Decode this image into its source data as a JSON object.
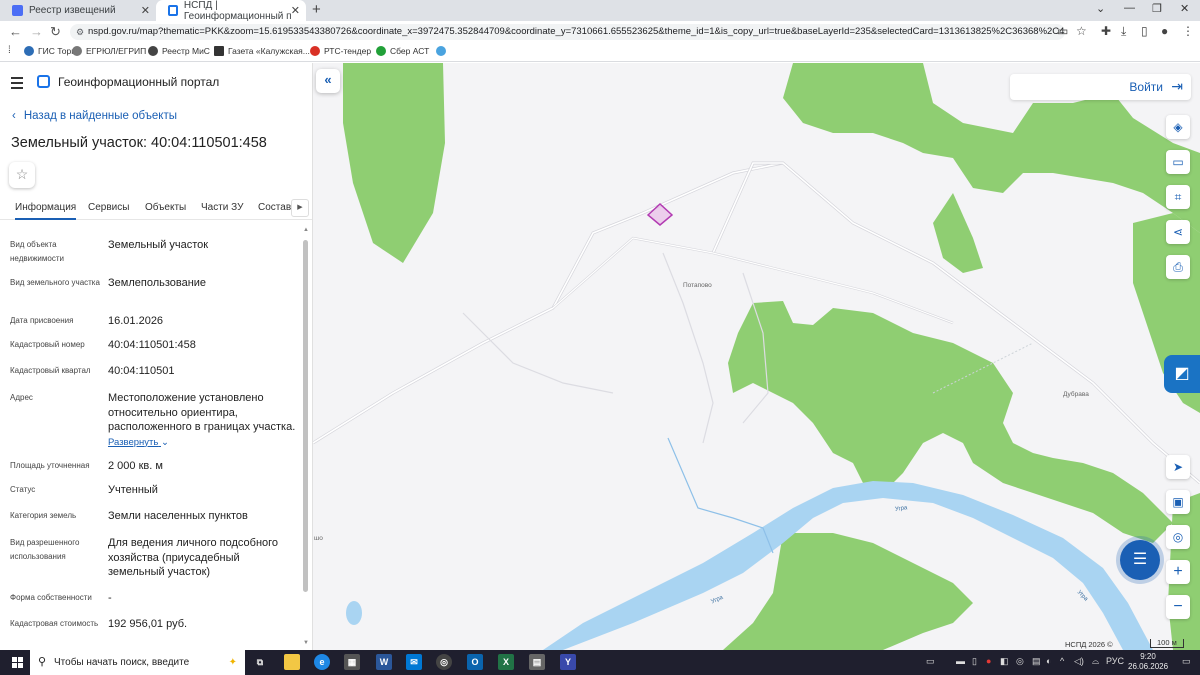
{
  "browser": {
    "tabs": [
      {
        "title": "Реестр извещений",
        "active": false
      },
      {
        "title": "НСПД | Геоинформационный п",
        "active": true
      }
    ],
    "url": "nspd.gov.ru/map?thematic=PKK&zoom=15.619533543380726&coordinate_x=3972475.352844709&coordinate_y=7310661.655523625&theme_id=1&is_copy_url=true&baseLayerId=235&selectedCard=1313613825%2C36368%2C40%3A04%3A110...",
    "bookmarks": [
      "ГИС Торги",
      "ЕГРЮЛ/ЕГРИП",
      "Реестр МиС",
      "Газета «Калужская...",
      "РТС-тендер",
      "Сбер АСТ"
    ]
  },
  "panel": {
    "portal_title": "Геоинформационный портал",
    "back_label": "Назад в найденные объекты",
    "object_title": "Земельный участок: 40:04:110501:458",
    "tabs": [
      "Информация",
      "Сервисы",
      "Объекты",
      "Части ЗУ",
      "Состав"
    ],
    "attributes": [
      {
        "label": "Вид объекта недвижимости",
        "value": "Земельный участок"
      },
      {
        "label": "Вид земельного участка",
        "value": "Землепользование"
      },
      {
        "label": "Дата присвоения",
        "value": "16.01.2026"
      },
      {
        "label": "Кадастровый номер",
        "value": "40:04:110501:458"
      },
      {
        "label": "Кадастровый квартал",
        "value": "40:04:110501"
      },
      {
        "label": "Адрес",
        "value": "Местоположение установлено относительно ориентира, расположенного в границах участка."
      },
      {
        "label": "Площадь уточненная",
        "value": "2 000 кв. м"
      },
      {
        "label": "Статус",
        "value": "Учтенный"
      },
      {
        "label": "Категория земель",
        "value": "Земли населенных пунктов"
      },
      {
        "label": "Вид разрешенного использования",
        "value": "Для ведения личного подсобного хозяйства (приусадебный земельный участок)"
      },
      {
        "label": "Форма собственности",
        "value": "-"
      },
      {
        "label": "Кадастровая стоимость",
        "value": "192 956,01 руб."
      }
    ],
    "expand_label": "Развернуть"
  },
  "map": {
    "login_label": "Войти",
    "labels": {
      "potapovo": "Потапово",
      "dubrava": "Дубрава",
      "ugra1": "Угра",
      "ugra2": "Угра",
      "ugra3": "Угра",
      "edge": "шо"
    },
    "copyright": "НСПД 2026 ©",
    "scale": "100 м",
    "colors": {
      "forest": "#8fce72",
      "water": "#a9d4f2",
      "parcel": "#b23ab2",
      "accent": "#1a5fb4"
    }
  },
  "taskbar": {
    "search_placeholder": "Чтобы начать поиск, введите",
    "language": "РУС",
    "time": "9:20",
    "date": "26.06.2026"
  }
}
